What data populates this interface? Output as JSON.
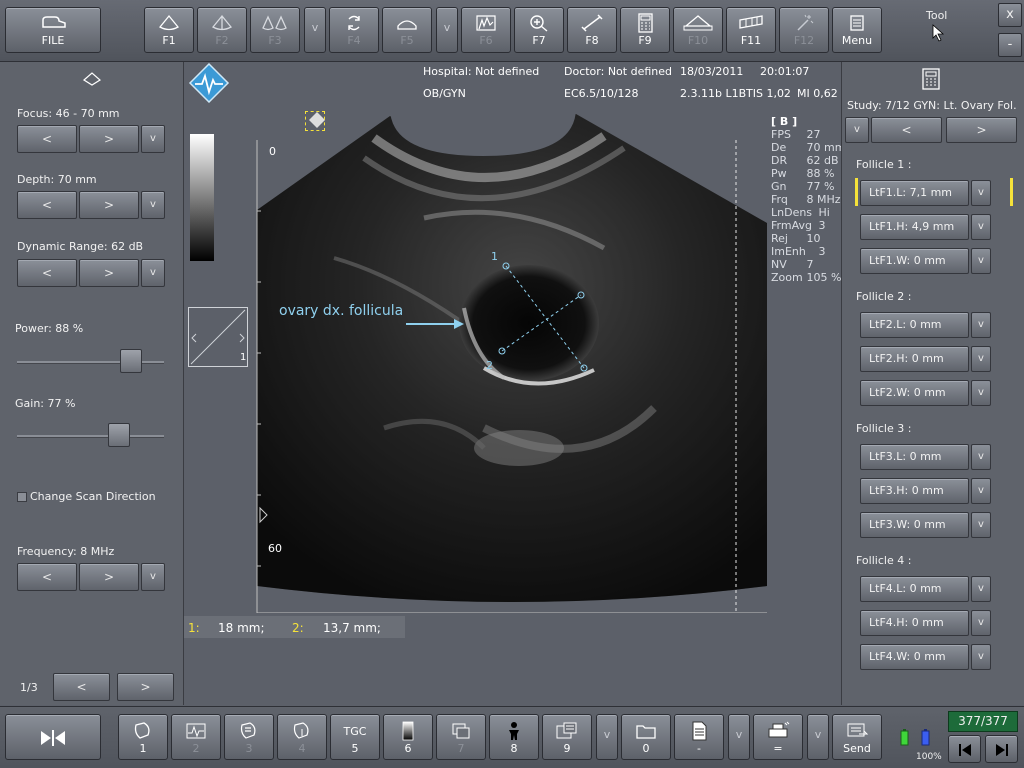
{
  "toolbar": {
    "file": "FILE",
    "f1": "F1",
    "f2": "F2",
    "f3": "F3",
    "v1": "v",
    "f4": "F4",
    "f5": "F5",
    "v2": "v",
    "f6": "F6",
    "f7": "F7",
    "f8": "F8",
    "f9": "F9",
    "f10": "F10",
    "f11": "F11",
    "f12": "F12",
    "menu": "Menu",
    "tool_label": "Tool",
    "close": "x",
    "minimize": "-"
  },
  "header": {
    "hospital": "Hospital: Not defined",
    "doctor": "Doctor: Not defined",
    "date": "18/03/2011",
    "time": "20:01:07",
    "preset": "OB/GYN",
    "probe": "EC6.5/10/128",
    "version": "2.3.11b L1B",
    "tis": "TIS 1,02",
    "mi": "MI 0,62"
  },
  "left": {
    "focus_label": "Focus: 46 - 70 mm",
    "depth_label": "Depth: 70 mm",
    "dynrange_label": "Dynamic Range: 62 dB",
    "power_label": "Power: 88 %",
    "power_level": 0.88,
    "gain_label": "Gain: 77 %",
    "gain_level": 0.77,
    "change_dir": "Change Scan Direction",
    "frequency_label": "Frequency: 8 MHz",
    "prev": "<",
    "next": ">",
    "v": "v",
    "page": "1/3"
  },
  "scan": {
    "depth_top": "0",
    "depth_bottom": "60",
    "annotation": "ovary dx. follicula",
    "caliper1": "1",
    "caliper2": "2",
    "mode": "[ B ]",
    "params": [
      [
        "FPS",
        "27"
      ],
      [
        "De",
        "70 mm"
      ],
      [
        "DR",
        "62 dB"
      ],
      [
        "Pw",
        "88 %"
      ],
      [
        "Gn",
        "77 %"
      ],
      [
        "Frq",
        "8 MHz"
      ],
      [
        "LnDens",
        "Hi"
      ],
      [
        "FrmAvg",
        "3"
      ],
      [
        "Rej",
        "10"
      ],
      [
        "ImEnh",
        "3"
      ],
      [
        "NV",
        "7"
      ],
      [
        "Zoom",
        "105 %"
      ]
    ],
    "view_num": "1",
    "meas1_idx": "1:",
    "meas1_val": "18 mm;",
    "meas2_idx": "2:",
    "meas2_val": "13,7 mm;"
  },
  "right": {
    "study": "Study:  7/12 GYN: Lt. Ovary Fol.",
    "v": "v",
    "prev": "<",
    "next": ">",
    "follicle1": "Follicle 1 :",
    "f1l": "LtF1.L: 7,1  mm",
    "f1h": "LtF1.H: 4,9  mm",
    "f1w": "LtF1.W: 0  mm",
    "follicle2": "Follicle 2 :",
    "f2l": "LtF2.L: 0  mm",
    "f2h": "LtF2.H: 0  mm",
    "f2w": "LtF2.W: 0  mm",
    "follicle3": "Follicle 3 :",
    "f3l": "LtF3.L: 0  mm",
    "f3h": "LtF3.H: 0  mm",
    "f3w": "LtF3.W: 0  mm",
    "follicle4": "Follicle 4 :",
    "f4l": "LtF4.L: 0  mm",
    "f4h": "LtF4.H: 0  mm",
    "f4w": "LtF4.W: 0  mm"
  },
  "bottom": {
    "b1": "1",
    "b2": "2",
    "b3": "3",
    "b4": "4",
    "tgc": "TGC",
    "b5": "5",
    "b6": "6",
    "b7": "7",
    "b8": "8",
    "b9": "9",
    "v": "v",
    "b0": "0",
    "dash": "-",
    "eq": "=",
    "send": "Send",
    "battery": "100%",
    "counter": "377/377"
  },
  "colors": {
    "accent_yellow": "#f5e23a",
    "caliper": "#8fd0ee",
    "counter_bg": "#1d6b3a"
  }
}
